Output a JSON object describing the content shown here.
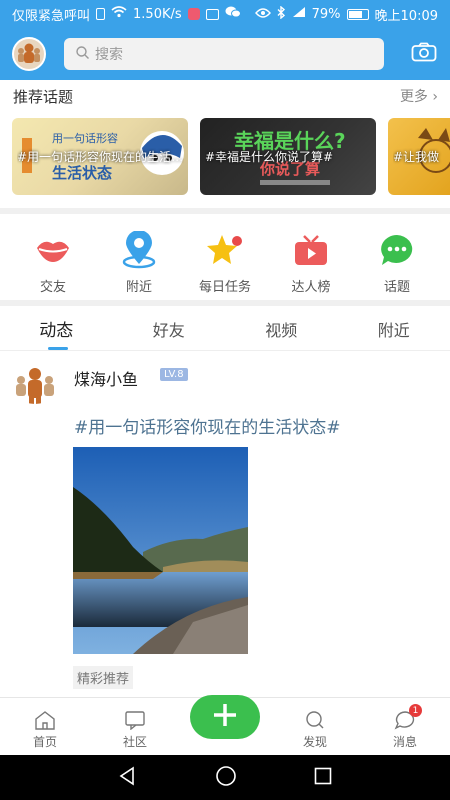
{
  "status": {
    "carrier": "仅限紧急呼叫",
    "speed": "1.50K/s",
    "battery": "79%",
    "time": "晚上10:09",
    "battery_level": 0.79
  },
  "header": {
    "search_placeholder": "搜索"
  },
  "recommend": {
    "title": "推荐话题",
    "more": "更多",
    "topics": [
      {
        "label": "#用一句话形容你现在的生活状态#"
      },
      {
        "label": "#幸福是什么你说了算#"
      },
      {
        "label": "#让我做"
      }
    ]
  },
  "shortcuts": [
    {
      "label": "交友",
      "icon": "lips-icon"
    },
    {
      "label": "附近",
      "icon": "location-pin-icon"
    },
    {
      "label": "每日任务",
      "icon": "star-icon"
    },
    {
      "label": "达人榜",
      "icon": "tv-icon"
    },
    {
      "label": "话题",
      "icon": "chat-bubble-icon"
    }
  ],
  "tabs": [
    "动态",
    "好友",
    "视频",
    "附近"
  ],
  "post": {
    "username": "煤海小鱼",
    "level": "LV.8",
    "title": "#用一句话形容你现在的生活状态#",
    "tag": "精彩推荐"
  },
  "bottom_nav": {
    "home": "首页",
    "community": "社区",
    "discover": "发现",
    "messages": "消息",
    "messages_badge": "1"
  },
  "colors": {
    "accent": "#3aa2e9",
    "fab": "#3bbf4e"
  }
}
